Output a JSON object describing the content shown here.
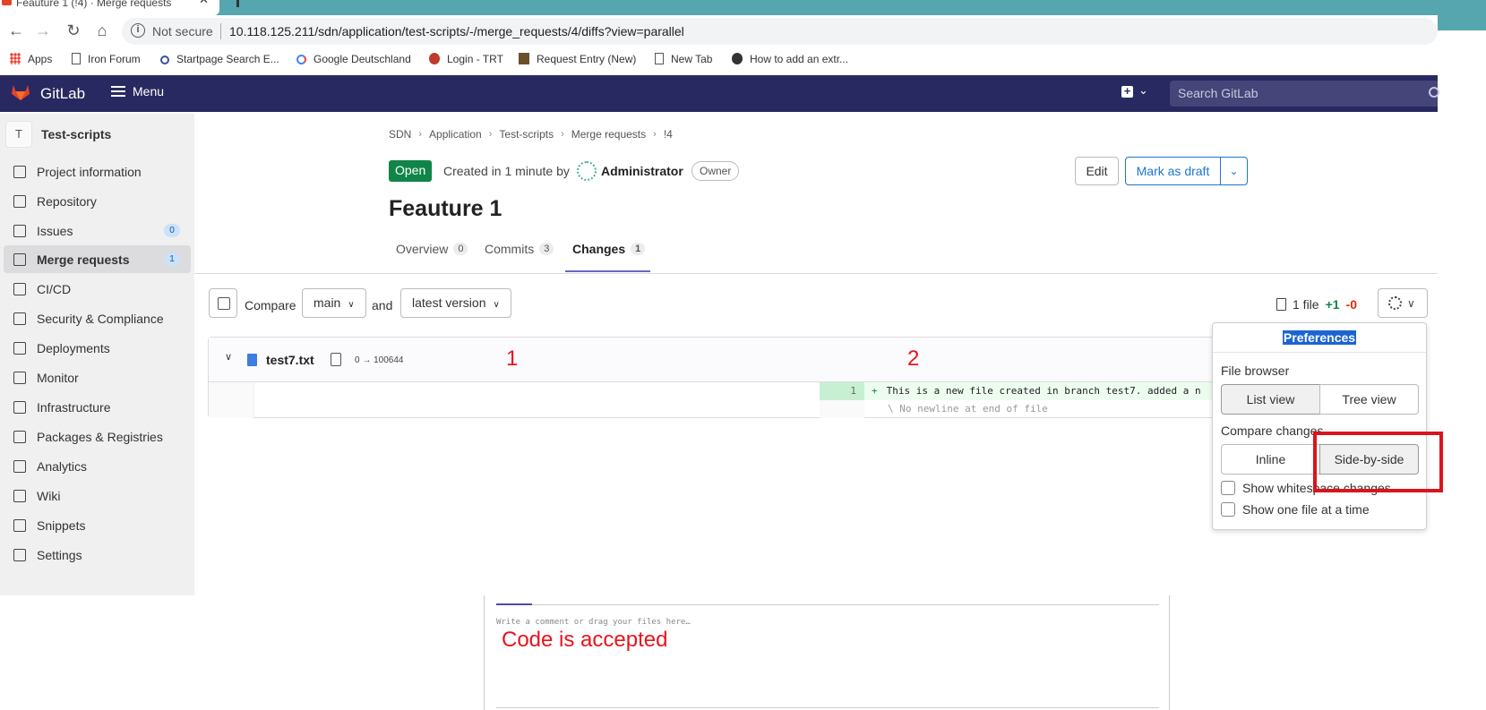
{
  "browser": {
    "tab_title": "Feauture 1 (!4) · Merge requests",
    "security_label": "Not secure",
    "url": "10.118.125.211/sdn/application/test-scripts/-/merge_requests/4/diffs?view=parallel",
    "bookmarks": [
      {
        "label": "Apps",
        "icon": "apps-grid-icon"
      },
      {
        "label": "Iron Forum",
        "icon": "page-icon"
      },
      {
        "label": "Startpage Search E...",
        "icon": "search-icon"
      },
      {
        "label": "Google Deutschland",
        "icon": "google-icon"
      },
      {
        "label": "Login - TRT",
        "icon": "trt-icon"
      },
      {
        "label": "Request Entry (New)",
        "icon": "request-icon"
      },
      {
        "label": "New Tab",
        "icon": "page-icon"
      },
      {
        "label": "How to add an extr...",
        "icon": "bird-icon"
      }
    ]
  },
  "header": {
    "app_name": "GitLab",
    "menu_label": "Menu",
    "search_placeholder": "Search GitLab",
    "brand_color": "#292961"
  },
  "sidebar": {
    "project_initial": "T",
    "project_name": "Test-scripts",
    "items": [
      {
        "label": "Project information",
        "icon": "info-icon"
      },
      {
        "label": "Repository",
        "icon": "document-icon"
      },
      {
        "label": "Issues",
        "icon": "issues-icon",
        "count": "0"
      },
      {
        "label": "Merge requests",
        "icon": "merge-request-icon",
        "count": "1",
        "active": true
      },
      {
        "label": "CI/CD",
        "icon": "rocket-icon"
      },
      {
        "label": "Security & Compliance",
        "icon": "shield-icon"
      },
      {
        "label": "Deployments",
        "icon": "deployments-icon"
      },
      {
        "label": "Monitor",
        "icon": "monitor-icon"
      },
      {
        "label": "Infrastructure",
        "icon": "cloud-icon"
      },
      {
        "label": "Packages & Registries",
        "icon": "package-icon"
      },
      {
        "label": "Analytics",
        "icon": "chart-icon"
      },
      {
        "label": "Wiki",
        "icon": "book-icon"
      },
      {
        "label": "Snippets",
        "icon": "scissors-icon"
      },
      {
        "label": "Settings",
        "icon": "gear-icon"
      }
    ]
  },
  "breadcrumb": [
    "SDN",
    "Application",
    "Test-scripts",
    "Merge requests",
    "!4"
  ],
  "mr": {
    "status": "Open",
    "created_text": "Created in 1 minute by",
    "author": "Administrator",
    "author_badge": "Owner",
    "edit_label": "Edit",
    "draft_label": "Mark as draft",
    "title": "Feauture 1",
    "tabs": [
      {
        "label": "Overview",
        "count": "0"
      },
      {
        "label": "Commits",
        "count": "3"
      },
      {
        "label": "Changes",
        "count": "1",
        "active": true
      }
    ]
  },
  "compare": {
    "label": "Compare",
    "source": "main",
    "and_label": "and",
    "target": "latest version",
    "files_label": "1 file",
    "additions": "+1",
    "deletions": "-0"
  },
  "diff": {
    "filename": "test7.txt",
    "mode": "0 → 100644",
    "line_number": "1",
    "added_line": "This is a new file created in branch test7. added a n",
    "no_newline": "\\ No newline at end of file"
  },
  "annotations": {
    "one": "1",
    "two": "2",
    "accepted": "Code is accepted"
  },
  "preferences": {
    "title": "Preferences",
    "file_browser_label": "File browser",
    "list_view": "List view",
    "tree_view": "Tree view",
    "compare_changes_label": "Compare changes",
    "inline": "Inline",
    "side_by_side": "Side-by-side",
    "whitespace_label": "Show whitespace changes",
    "one_file_label": "Show one file at a time"
  },
  "comment": {
    "placeholder": "Write a comment or drag your files here…"
  }
}
